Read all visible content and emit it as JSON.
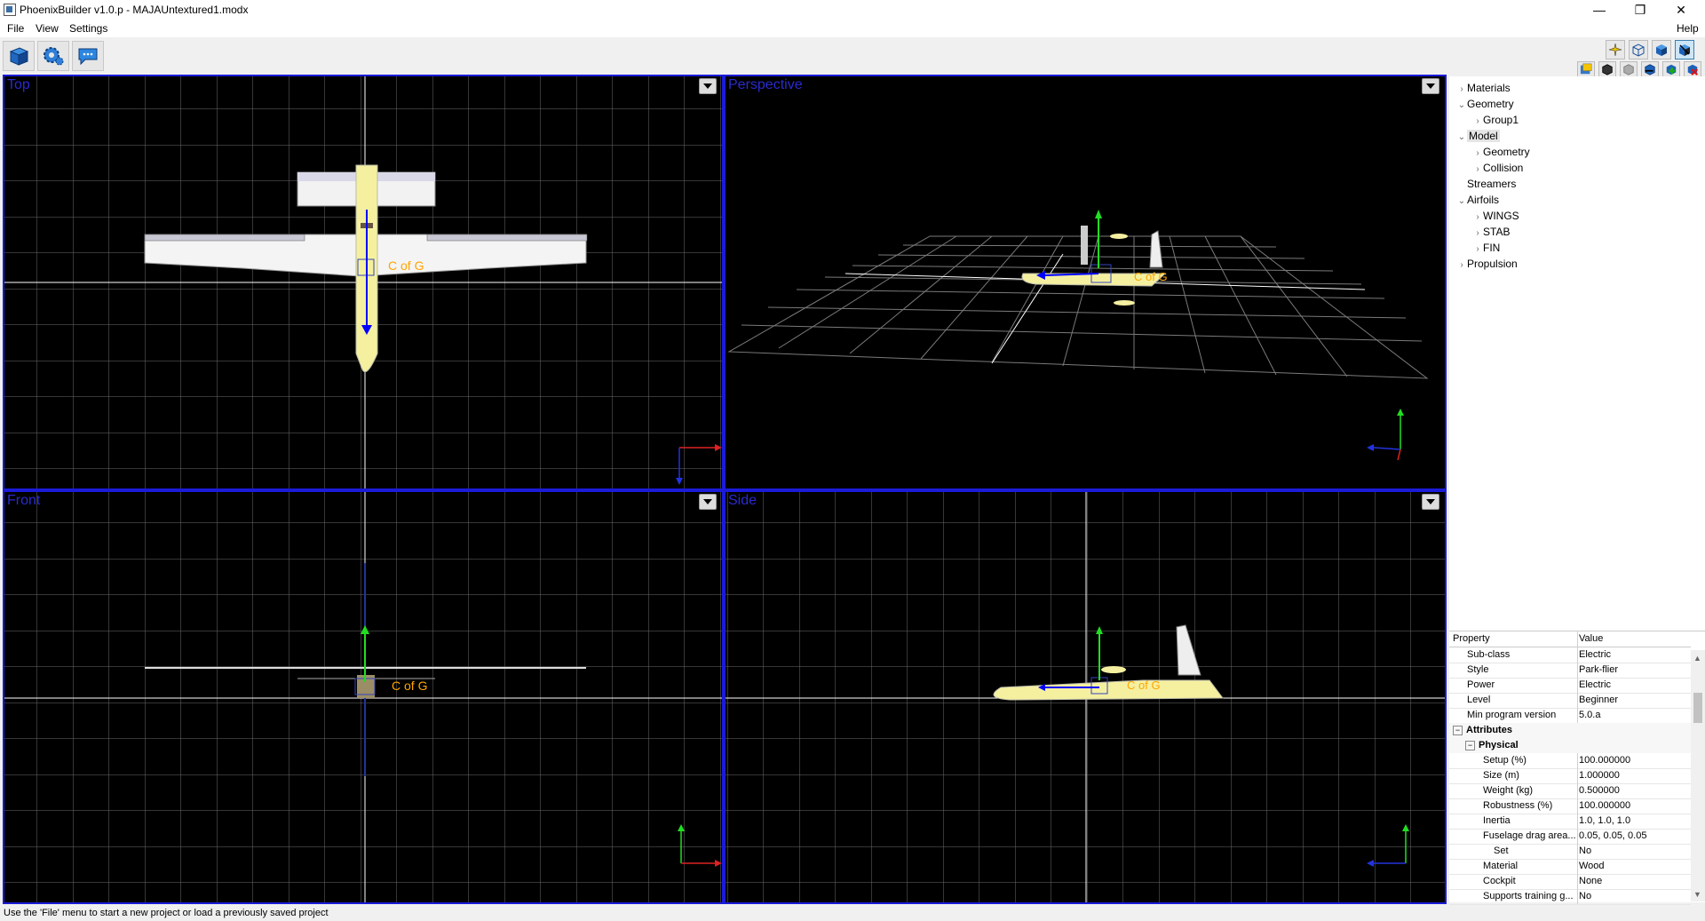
{
  "window": {
    "title": "PhoenixBuilder v1.0.p  - MAJAUntextured1.modx",
    "minimize": "—",
    "restore": "❐",
    "close": "✕"
  },
  "menu": {
    "file": "File",
    "view": "View",
    "settings": "Settings",
    "help": "Help"
  },
  "toolbar": {
    "left_icons": [
      "cube-icon",
      "gear-icon",
      "chat-icon"
    ],
    "right_top_icons": [
      "aircraft-view-icon",
      "wireframe-cube-icon",
      "solid-cube-icon",
      "textured-cube-icon"
    ],
    "right_bottom_icons": [
      "materials-icon",
      "dark-cube-icon",
      "gray-cube-icon",
      "blue-cube-icon",
      "add-icon",
      "delete-icon"
    ]
  },
  "viewports": {
    "top": "Top",
    "perspective": "Perspective",
    "front": "Front",
    "side": "Side",
    "cofg": "C of G"
  },
  "tree": [
    {
      "label": "Materials",
      "level": 0,
      "arrow": "›"
    },
    {
      "label": "Geometry",
      "level": 0,
      "arrow": "⌄"
    },
    {
      "label": "Group1",
      "level": 1,
      "arrow": "›"
    },
    {
      "label": "Model",
      "level": 0,
      "arrow": "⌄",
      "selected": true
    },
    {
      "label": "Geometry",
      "level": 1,
      "arrow": "›"
    },
    {
      "label": "Collision",
      "level": 1,
      "arrow": "›"
    },
    {
      "label": "Streamers",
      "level": 0,
      "arrow": ""
    },
    {
      "label": "Airfoils",
      "level": 0,
      "arrow": "⌄"
    },
    {
      "label": "WINGS",
      "level": 1,
      "arrow": "›"
    },
    {
      "label": "STAB",
      "level": 1,
      "arrow": "›"
    },
    {
      "label": "FIN",
      "level": 1,
      "arrow": "›"
    },
    {
      "label": "Propulsion",
      "level": 0,
      "arrow": "›"
    }
  ],
  "properties": {
    "header_property": "Property",
    "header_value": "Value",
    "rows": [
      {
        "name": "Sub-class",
        "value": "Electric",
        "indent": 1
      },
      {
        "name": "Style",
        "value": "Park-flier",
        "indent": 1
      },
      {
        "name": "Power",
        "value": "Electric",
        "indent": 1
      },
      {
        "name": "Level",
        "value": "Beginner",
        "indent": 1
      },
      {
        "name": "Min program version",
        "value": "5.0.a",
        "indent": 1
      },
      {
        "name": "Attributes",
        "value": "",
        "header": true,
        "indent": 0
      },
      {
        "name": "Physical",
        "value": "",
        "header": true,
        "indent": 1
      },
      {
        "name": "Setup (%)",
        "value": "100.000000",
        "indent": 2
      },
      {
        "name": "Size (m)",
        "value": "1.000000",
        "indent": 2
      },
      {
        "name": "Weight (kg)",
        "value": "0.500000",
        "indent": 2
      },
      {
        "name": "Robustness (%)",
        "value": "100.000000",
        "indent": 2
      },
      {
        "name": "Inertia",
        "value": "1.0, 1.0, 1.0",
        "indent": 2
      },
      {
        "name": "Fuselage drag area...",
        "value": "0.05, 0.05, 0.05",
        "indent": 2
      },
      {
        "name": "Set",
        "value": "No",
        "indent": 3
      },
      {
        "name": "Material",
        "value": "Wood",
        "indent": 2
      },
      {
        "name": "Cockpit",
        "value": "None",
        "indent": 2
      },
      {
        "name": "Supports training g...",
        "value": "No",
        "indent": 2
      }
    ]
  },
  "status": "Use the 'File' menu to start a new project or load a previously saved project",
  "colors": {
    "viewport_border": "#1b1bd8",
    "grid": "#666666",
    "axis": "#ffffff",
    "model": "#f5f0a0"
  }
}
